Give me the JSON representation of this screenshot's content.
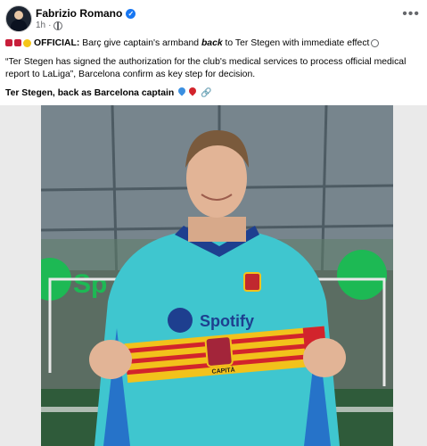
{
  "post": {
    "author": "Fabrizio Romano",
    "time": "1h",
    "more": "•••",
    "line1_tag": "OFFICIAL:",
    "line1_a": " Barç give captain's armband ",
    "line1_b": "back",
    "line1_c": " to Ter Stegen with immediate effect",
    "quote": "“Ter Stegen has signed the authorization for the club's medical services to process official medical report to LaLiga”, Barcelona confirm as key step for decision.",
    "headline": "Ter Stegen, back as Barcelona captain"
  },
  "photo": {
    "sponsor_left": "Sp",
    "shirt_sponsor": "Spotify",
    "armband_label": "CAPITÀ"
  },
  "icons": {
    "verified": "verified-badge-icon",
    "globe": "globe-icon",
    "more": "more-options-icon"
  },
  "colors": {
    "accent": "#1877f2",
    "meta": "#65676b",
    "shirt": "#3fc6cf",
    "armband_yellow": "#f2c21b",
    "armband_red": "#d2242c",
    "spotify_green": "#1db954"
  }
}
